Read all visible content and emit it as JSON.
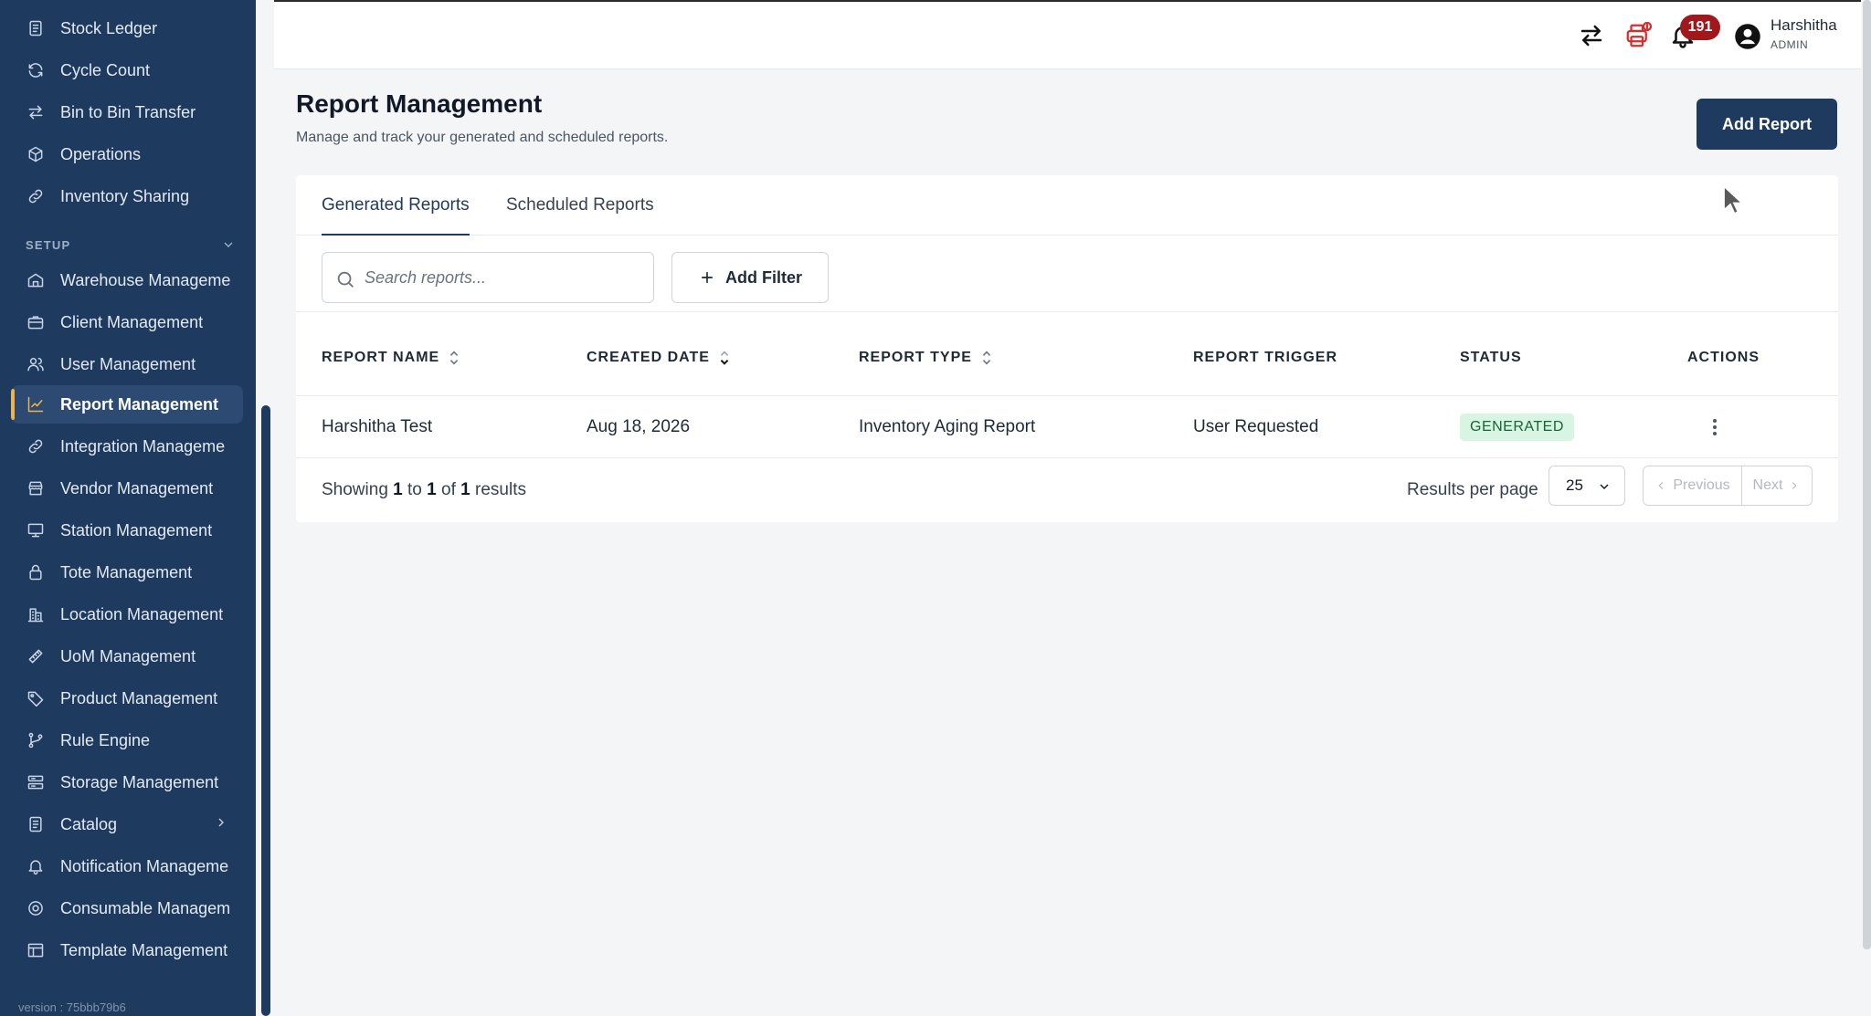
{
  "sidebar": {
    "items": [
      {
        "label": "Stock Ledger",
        "icon": "ledger-icon"
      },
      {
        "label": "Cycle Count",
        "icon": "refresh-icon"
      },
      {
        "label": "Bin to Bin Transfer",
        "icon": "transfer-icon"
      },
      {
        "label": "Operations",
        "icon": "cube-icon"
      },
      {
        "label": "Inventory Sharing",
        "icon": "link-icon"
      }
    ],
    "section_label": "SETUP",
    "setup_items": [
      {
        "label": "Warehouse Manageme",
        "icon": "warehouse-icon"
      },
      {
        "label": "Client Management",
        "icon": "briefcase-icon"
      },
      {
        "label": "User Management",
        "icon": "users-icon"
      },
      {
        "label": "Report Management",
        "icon": "chart-line-icon",
        "active": true
      },
      {
        "label": "Integration Manageme",
        "icon": "link-icon"
      },
      {
        "label": "Vendor Management",
        "icon": "store-icon"
      },
      {
        "label": "Station Management",
        "icon": "monitor-icon"
      },
      {
        "label": "Tote Management",
        "icon": "lock-icon"
      },
      {
        "label": "Location Management",
        "icon": "building-icon"
      },
      {
        "label": "UoM Management",
        "icon": "ruler-icon"
      },
      {
        "label": "Product Management",
        "icon": "tag-icon"
      },
      {
        "label": "Rule Engine",
        "icon": "branch-icon"
      },
      {
        "label": "Storage Management",
        "icon": "storage-icon"
      },
      {
        "label": "Catalog",
        "icon": "catalog-icon"
      },
      {
        "label": "Notification Manageme",
        "icon": "bell-icon"
      },
      {
        "label": "Consumable Managem",
        "icon": "at-icon"
      },
      {
        "label": "Template Management",
        "icon": "table-icon"
      }
    ],
    "version": "version : 75bbb79b6"
  },
  "topbar": {
    "notification_count": "191",
    "user_name": "Harshitha",
    "user_role": "ADMIN"
  },
  "page": {
    "title": "Report Management",
    "subtitle": "Manage and track your generated and scheduled reports.",
    "add_report_label": "Add Report"
  },
  "tabs": [
    {
      "label": "Generated Reports",
      "active": true
    },
    {
      "label": "Scheduled Reports",
      "active": false
    }
  ],
  "toolbar": {
    "search_placeholder": "Search reports...",
    "add_filter_label": "Add Filter"
  },
  "table": {
    "columns": [
      "REPORT NAME",
      "CREATED DATE",
      "REPORT TYPE",
      "REPORT TRIGGER",
      "STATUS",
      "ACTIONS"
    ],
    "rows": [
      {
        "report_name": "Harshitha Test",
        "created_date": "Aug 18, 2026",
        "report_type": "Inventory Aging Report",
        "report_trigger": "User Requested",
        "status": "GENERATED"
      }
    ]
  },
  "footer": {
    "showing_prefix": "Showing",
    "from": "1",
    "to_word": "to",
    "to": "1",
    "of_word": "of",
    "total": "1",
    "results_word": "results",
    "results_per_page_label": "Results per page",
    "per_page_value": "25",
    "previous_label": "Previous",
    "next_label": "Next"
  },
  "colors": {
    "sidebar_bg": "#1e3a5f",
    "accent": "#1e3a5f",
    "active_indicator": "#f0b44c",
    "badge": "#a0181c",
    "status_generated_bg": "#d8f5e3",
    "status_generated_text": "#166534",
    "printer_alert": "#d32f2f"
  }
}
